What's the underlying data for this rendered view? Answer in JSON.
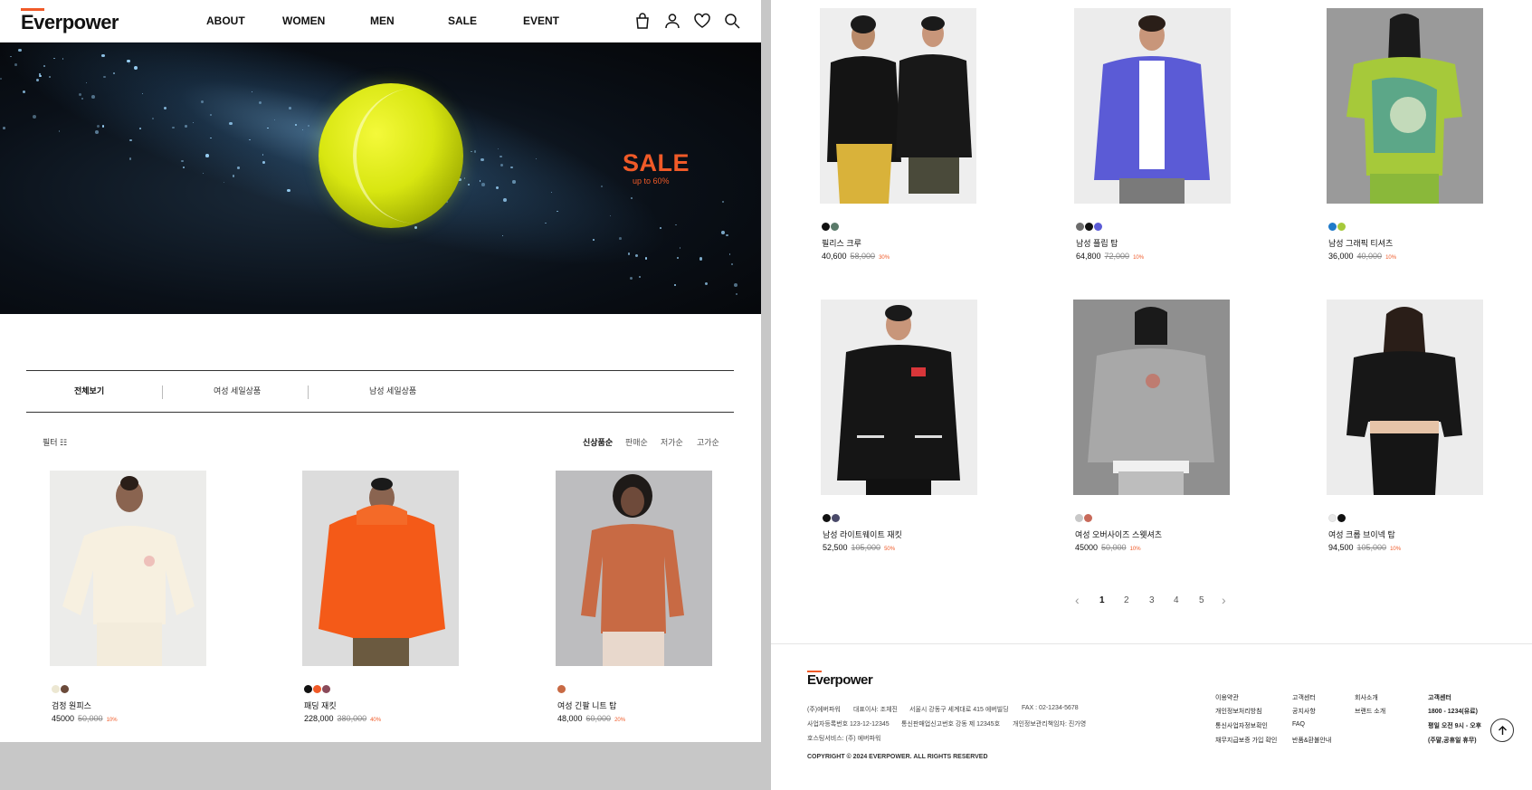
{
  "brand": {
    "logo": "Everpower",
    "accent": "#f05a28"
  },
  "nav": [
    "ABOUT",
    "WOMEN",
    "MEN",
    "SALE",
    "EVENT"
  ],
  "header_icons": [
    "shopping-bag-icon",
    "user-icon",
    "heart-icon",
    "search-icon"
  ],
  "hero": {
    "title": "SALE",
    "subtitle": "up to 60%"
  },
  "tabs": [
    "전체보기",
    "여성 세일상품",
    "남성 세일상품"
  ],
  "filter_label": "필터 ☷",
  "sort": [
    "신상품순",
    "판매순",
    "저가순",
    "고가순"
  ],
  "products_left": [
    {
      "name": "검정 원피스",
      "price": "45000",
      "original": "50,000",
      "discount": "10%",
      "colors": [
        "#ece7d2",
        "#6b4a3a"
      ]
    },
    {
      "name": "패딩 재킷",
      "price": "228,000",
      "original": "380,000",
      "discount": "40%",
      "colors": [
        "#111111",
        "#f05a28",
        "#8a4a5a"
      ]
    },
    {
      "name": "여성 긴팔 니트 탑",
      "price": "48,000",
      "original": "60,000",
      "discount": "20%",
      "colors": [
        "#c86a44"
      ]
    }
  ],
  "products_right": [
    {
      "name": "필리스 크루",
      "price": "40,600",
      "original": "58,000",
      "discount": "30%",
      "colors": [
        "#111111",
        "#5a7a6a"
      ]
    },
    {
      "name": "남성 플립 탑",
      "price": "64,800",
      "original": "72,000",
      "discount": "10%",
      "colors": [
        "#6b6b6b",
        "#111111",
        "#5b5bd6"
      ]
    },
    {
      "name": "남성 그래픽 티셔츠",
      "price": "36,000",
      "original": "40,000",
      "discount": "10%",
      "colors": [
        "#1f7ac9",
        "#a6c93a"
      ]
    },
    {
      "name": "남성 라이트웨이트 재킷",
      "price": "52,500",
      "original": "105,000",
      "discount": "50%",
      "colors": [
        "#111111",
        "#4a4a6a"
      ]
    },
    {
      "name": "여성 오버사이즈 스웻셔츠",
      "price": "45000",
      "original": "50,000",
      "discount": "10%",
      "colors": [
        "#c8c8c8",
        "#c86a5a"
      ]
    },
    {
      "name": "여성 크롭 브이넥 탑",
      "price": "94,500",
      "original": "105,000",
      "discount": "10%",
      "colors": [
        "#e8e8e8",
        "#111111"
      ]
    }
  ],
  "pagination": {
    "prev": "‹",
    "pages": [
      "1",
      "2",
      "3",
      "4",
      "5"
    ],
    "next": "›",
    "current": "1"
  },
  "footer": {
    "logo": "Everpower",
    "info_line1": [
      "(주)에버파워",
      "대표이사: 조체진",
      "서울시 강동구 세계대로 415 에버빌딩",
      "FAX : 02-1234-5678"
    ],
    "info_line2": [
      "사업자등록번호 123-12-12345",
      "통신판매업신고번호 강동 제 12345호",
      "개인정보관리책임자: 진가영"
    ],
    "info_line3": "호스팅서비스: (주) 에버파워",
    "copyright": "COPYRIGHT © 2024 EVERPOWER. ALL RIGHTS RESERVED",
    "col1": [
      "이용약관",
      "개인정보처리방침",
      "통신사업자정보확인",
      "채무지급보증 가입 확인"
    ],
    "col2": [
      "고객센터",
      "공지사항",
      "FAQ",
      "반품&환불안내"
    ],
    "col3": [
      "회사소개",
      "브랜드 소개"
    ],
    "col4": [
      "고객센터",
      "1800 - 1234(유료)",
      "평일 오전 9시 - 오후",
      "(주말,공휴일 휴무)"
    ]
  }
}
